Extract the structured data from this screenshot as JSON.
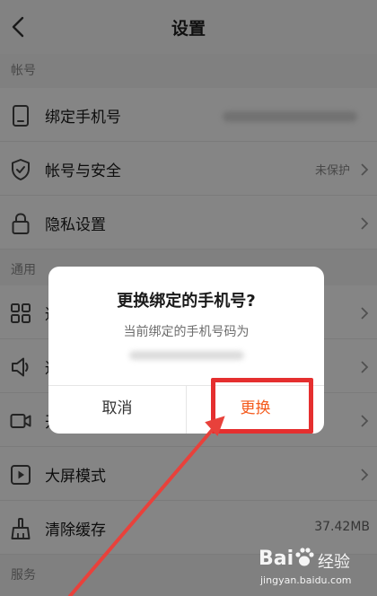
{
  "header": {
    "title": "设置"
  },
  "sections": {
    "account": "帐号",
    "general": "通用",
    "services": "服务"
  },
  "rows": {
    "bind_phone": {
      "label": "绑定手机号",
      "icon": "phone-icon"
    },
    "account_security": {
      "label": "帐号与安全",
      "value": "未保护",
      "icon": "shield-icon"
    },
    "privacy": {
      "label": "隐私设置",
      "icon": "lock-icon"
    },
    "row4": {
      "label": "通",
      "icon": "grid-icon"
    },
    "row5": {
      "label": "通",
      "icon": "speaker-icon"
    },
    "row6": {
      "label": "开",
      "icon": "video-icon"
    },
    "big_screen": {
      "label": "大屏模式",
      "icon": "play-icon"
    },
    "clear_cache": {
      "label": "清除缓存",
      "value": "37.42MB",
      "icon": "broom-icon"
    }
  },
  "dialog": {
    "title": "更换绑定的手机号?",
    "message": "当前绑定的手机号码为",
    "cancel": "取消",
    "confirm": "更换"
  },
  "colors": {
    "accent": "#f45a1c",
    "annotation_red": "#e52f2f"
  },
  "watermark": {
    "logo": "Bai",
    "text": "经验",
    "url": "jingyan.baidu.com"
  }
}
